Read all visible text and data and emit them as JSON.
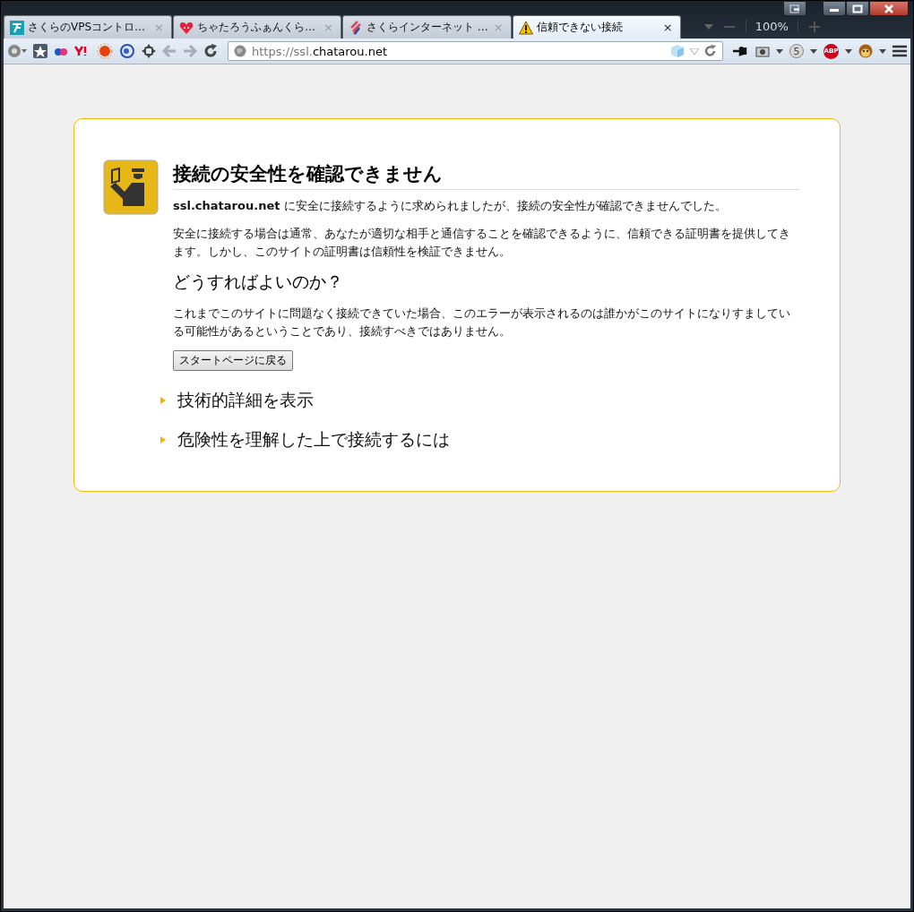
{
  "tabs": [
    {
      "title": "さくらのVPSコントロ…",
      "selected": false,
      "close": "×"
    },
    {
      "title": "ちゃたろうふぁんくら…",
      "selected": false,
      "close": "×"
    },
    {
      "title": "さくらインターネット …",
      "selected": false,
      "close": "×"
    },
    {
      "title": "信頼できない接続",
      "selected": true,
      "close": "×"
    }
  ],
  "zoom": {
    "reading": "100%"
  },
  "address_bar": {
    "prefix": "https://ssl.",
    "domain": "chatarou.net"
  },
  "toolbar": {
    "counter_badge": "5",
    "adblock_label": "ABP"
  },
  "error_page": {
    "title": "接続の安全性を確認できません",
    "paragraphs": [
      "**ssl.chatarou.net** に安全に接続するように求められましたが、接続の安全性が確認できませんでした。",
      "安全に接続する場合は通常、あなたが適切な相手と通信することを確認できるように、信頼できる証明書を提供してきます。しかし、このサイトの証明書は信頼性を検証できません。"
    ],
    "subheading": "どうすればよいのか？",
    "advice": "これまでこのサイトに問題なく接続できていた場合、このエラーが表示されるのは誰かがこのサイトになりすましている可能性があるということであり、接続すべきではありません。",
    "button": "スタートページに戻る",
    "sections": [
      {
        "title": "技術的詳細を表示",
        "expanded": false
      },
      {
        "title": "危険性を理解した上で接続するには",
        "expanded": false
      }
    ]
  }
}
